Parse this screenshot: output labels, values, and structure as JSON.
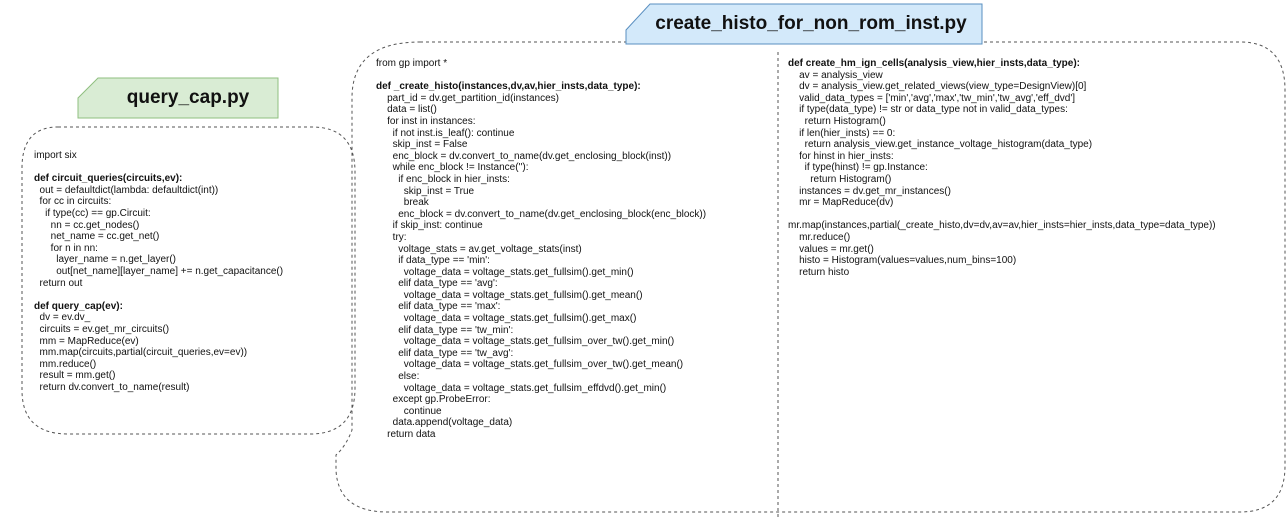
{
  "left_panel": {
    "tab_title": "query_cap.py",
    "lines": [
      "import six",
      "",
      "def circuit_queries(circuits,ev):",
      "  out = defaultdict(lambda: defaultdict(int))",
      "  for cc in circuits:",
      "    if type(cc) == gp.Circuit:",
      "      nn = cc.get_nodes()",
      "      net_name = cc.get_net()",
      "      for n in nn:",
      "        layer_name = n.get_layer()",
      "        out[net_name][layer_name] += n.get_capacitance()",
      "  return out",
      "",
      "def query_cap(ev):",
      "  dv = ev.dv_",
      "  circuits = ev.get_mr_circuits()",
      "  mm = MapReduce(ev)",
      "  mm.map(circuits,partial(circuit_queries,ev=ev))",
      "  mm.reduce()",
      "  result = mm.get()",
      "  return dv.convert_to_name(result)"
    ]
  },
  "right_panel": {
    "tab_title": "create_histo_for_non_rom_inst.py",
    "col1_lines": [
      "from gp import *",
      "",
      "def _create_histo(instances,dv,av,hier_insts,data_type):",
      "    part_id = dv.get_partition_id(instances)",
      "    data = list()",
      "    for inst in instances:",
      "      if not inst.is_leaf(): continue",
      "      skip_inst = False",
      "      enc_block = dv.convert_to_name(dv.get_enclosing_block(inst))",
      "      while enc_block != Instance(''):",
      "        if enc_block in hier_insts:",
      "          skip_inst = True",
      "          break",
      "        enc_block = dv.convert_to_name(dv.get_enclosing_block(enc_block))",
      "      if skip_inst: continue",
      "      try:",
      "        voltage_stats = av.get_voltage_stats(inst)",
      "        if data_type == 'min':",
      "          voltage_data = voltage_stats.get_fullsim().get_min()",
      "        elif data_type == 'avg':",
      "          voltage_data = voltage_stats.get_fullsim().get_mean()",
      "        elif data_type == 'max':",
      "          voltage_data = voltage_stats.get_fullsim().get_max()",
      "        elif data_type == 'tw_min':",
      "          voltage_data = voltage_stats.get_fullsim_over_tw().get_min()",
      "        elif data_type == 'tw_avg':",
      "          voltage_data = voltage_stats.get_fullsim_over_tw().get_mean()",
      "        else:",
      "          voltage_data = voltage_stats.get_fullsim_effdvd().get_min()",
      "      except gp.ProbeError:",
      "          continue",
      "      data.append(voltage_data)",
      "    return data"
    ],
    "col2_lines": [
      "def create_hm_ign_cells(analysis_view,hier_insts,data_type):",
      "    av = analysis_view",
      "    dv = analysis_view.get_related_views(view_type=DesignView)[0]",
      "    valid_data_types = ['min','avg','max','tw_min','tw_avg','eff_dvd']",
      "    if type(data_type) != str or data_type not in valid_data_types:",
      "      return Histogram()",
      "    if len(hier_insts) == 0:",
      "      return analysis_view.get_instance_voltage_histogram(data_type)",
      "    for hinst in hier_insts:",
      "      if type(hinst) != gp.Instance:",
      "        return Histogram()",
      "    instances = dv.get_mr_instances()",
      "    mr = MapReduce(dv)",
      "",
      "mr.map(instances,partial(_create_histo,dv=dv,av=av,hier_insts=hier_insts,data_type=data_type))",
      "    mr.reduce()",
      "    values = mr.get()",
      "    histo = Histogram(values=values,num_bins=100)",
      "    return histo"
    ]
  },
  "colors": {
    "left_tab_fill": "#d9ecd4",
    "left_tab_stroke": "#8fbf7f",
    "right_tab_fill": "#d3e9fa",
    "right_tab_stroke": "#5a8fc0",
    "panel_border": "#555555"
  }
}
